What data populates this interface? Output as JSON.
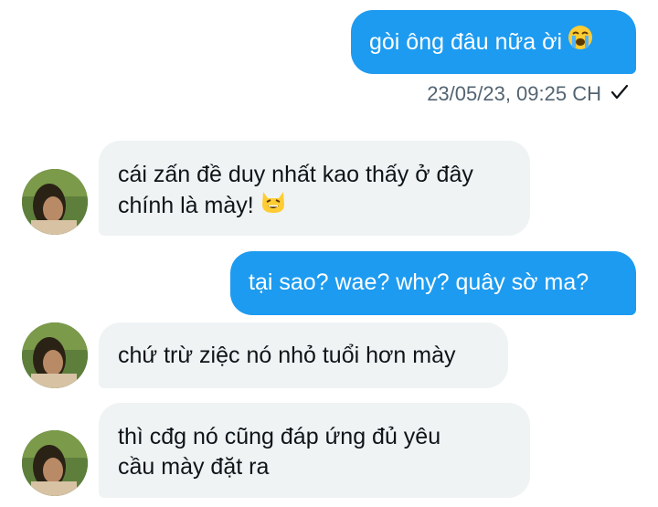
{
  "conversation": {
    "messages": [
      {
        "sender": "me",
        "text": "gòi ông đâu nữa ời",
        "emoji": "loudly-crying-face-icon"
      },
      {
        "sender": "other",
        "lines": [
          "cái zấn đề duy nhất kao thấy ở đây",
          "chính là mày!"
        ],
        "emoji": "grinning-cat-icon"
      },
      {
        "sender": "me",
        "text": "tại sao? wae? why? quây sờ ma?"
      },
      {
        "sender": "other",
        "lines": [
          "chứ trừ ziệc nó nhỏ tuổi hơn mày"
        ]
      },
      {
        "sender": "other",
        "lines": [
          "thì cđg nó cũng đáp ứng đủ yêu",
          "cầu mày đặt ra"
        ]
      }
    ],
    "first_message_meta": {
      "timestamp": "23/05/23, 09:25 CH",
      "status_icon": "check-icon"
    }
  },
  "colors": {
    "sent_bubble": "#1d9bf0",
    "received_bubble": "#eff3f4",
    "text_dark": "#0f1419",
    "meta_text": "#536471"
  }
}
